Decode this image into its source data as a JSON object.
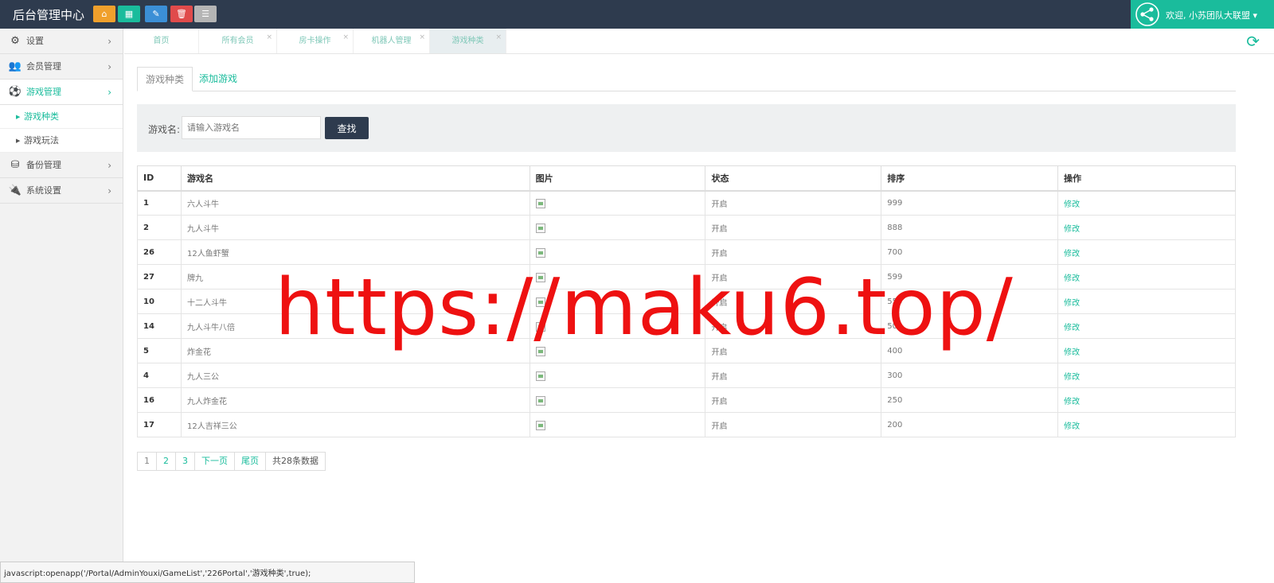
{
  "header": {
    "brand": "后台管理中心",
    "quick_buttons": [
      {
        "icon": "home-icon",
        "glyph": "⌂",
        "color": "#f0a02c"
      },
      {
        "icon": "grid-icon",
        "glyph": "▦",
        "color": "#1abc9c"
      },
      {
        "icon": "pencil-icon",
        "glyph": "✎",
        "color": "#3b8fd6"
      },
      {
        "icon": "trash-icon",
        "glyph": "🗑",
        "color": "#e04b4b"
      },
      {
        "icon": "list-icon",
        "glyph": "☰",
        "color": "#b5b5b5"
      }
    ],
    "welcome": "欢迎, 小苏团队大联盟 ▾"
  },
  "sidebar": {
    "items": [
      {
        "label": "设置",
        "icon": "gears-icon",
        "glyph": "⚙"
      },
      {
        "label": "会员管理",
        "icon": "users-icon",
        "glyph": "👥"
      },
      {
        "label": "游戏管理",
        "icon": "soccer-ball-icon",
        "glyph": "⚽"
      },
      {
        "label": "备份管理",
        "icon": "database-icon",
        "glyph": "⛁"
      },
      {
        "label": "系统设置",
        "icon": "plug-icon",
        "glyph": "🔌"
      }
    ],
    "sub_items": [
      {
        "label": "游戏种类"
      },
      {
        "label": "游戏玩法"
      }
    ]
  },
  "page_tabs": [
    {
      "label": "首页",
      "closable": false
    },
    {
      "label": "所有会员",
      "closable": true
    },
    {
      "label": "房卡操作",
      "closable": true
    },
    {
      "label": "机器人管理",
      "closable": true
    },
    {
      "label": "游戏种类",
      "closable": true
    }
  ],
  "content_tabs": {
    "active": "游戏种类",
    "add": "添加游戏"
  },
  "search": {
    "label": "游戏名:",
    "placeholder": "请输入游戏名",
    "button": "查找"
  },
  "table": {
    "headers": [
      "ID",
      "游戏名",
      "图片",
      "状态",
      "排序",
      "操作"
    ],
    "rows": [
      {
        "id": "1",
        "name": "六人斗牛",
        "status": "开启",
        "order": "999",
        "op": "修改"
      },
      {
        "id": "2",
        "name": "九人斗牛",
        "status": "开启",
        "order": "888",
        "op": "修改"
      },
      {
        "id": "26",
        "name": "12人鱼虾蟹",
        "status": "开启",
        "order": "700",
        "op": "修改"
      },
      {
        "id": "27",
        "name": "牌九",
        "status": "开启",
        "order": "599",
        "op": "修改"
      },
      {
        "id": "10",
        "name": "十二人斗牛",
        "status": "开启",
        "order": "555",
        "op": "修改"
      },
      {
        "id": "14",
        "name": "九人斗牛八倍",
        "status": "开启",
        "order": "500",
        "op": "修改"
      },
      {
        "id": "5",
        "name": "炸金花",
        "status": "开启",
        "order": "400",
        "op": "修改"
      },
      {
        "id": "4",
        "name": "九人三公",
        "status": "开启",
        "order": "300",
        "op": "修改"
      },
      {
        "id": "16",
        "name": "九人炸金花",
        "status": "开启",
        "order": "250",
        "op": "修改"
      },
      {
        "id": "17",
        "name": "12人吉祥三公",
        "status": "开启",
        "order": "200",
        "op": "修改"
      }
    ]
  },
  "pagination": {
    "pages": [
      "1",
      "2",
      "3"
    ],
    "next": "下一页",
    "last": "尾页",
    "total": "共28条数据"
  },
  "status_bar": "javascript:openapp('/Portal/AdminYouxi/GameList','226Portal','游戏种类',true);",
  "watermark": "https://maku6.top/",
  "colors": {
    "accent": "#1abc9c",
    "topbar": "#2e3b4e"
  }
}
